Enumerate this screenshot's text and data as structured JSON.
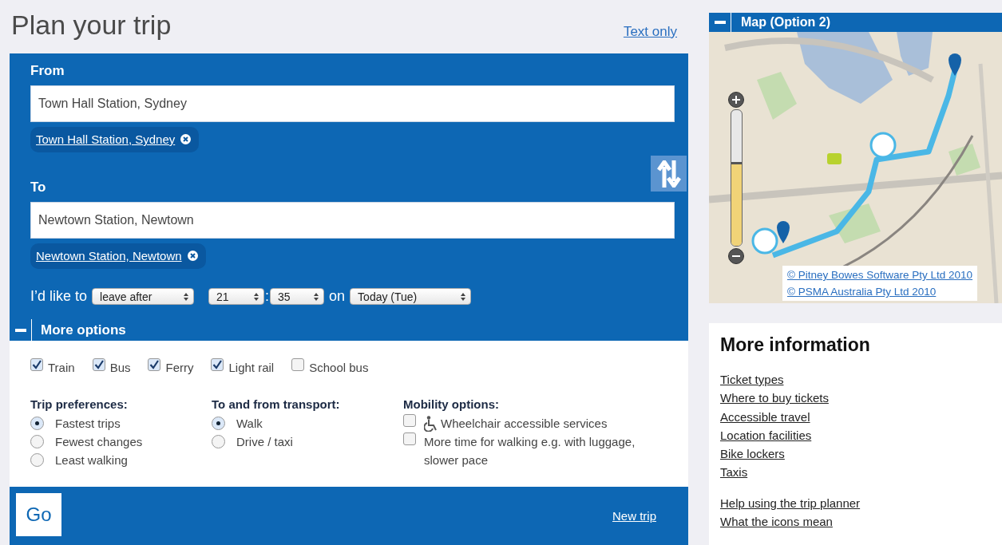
{
  "title": "Plan your trip",
  "text_only_link": "Text only",
  "from": {
    "label": "From",
    "value": "Town Hall Station, Sydney",
    "chip": "Town Hall Station, Sydney"
  },
  "to": {
    "label": "To",
    "value": "Newtown Station, Newtown",
    "chip": "Newtown Station, Newtown"
  },
  "when": {
    "prefix": "I’d like to",
    "mode": "leave after",
    "hour": "21",
    "separator": ":",
    "minute": "35",
    "on": "on",
    "day": "Today (Tue)"
  },
  "more_options": {
    "label": "More options",
    "expanded": true
  },
  "modes": [
    {
      "label": "Train",
      "checked": true
    },
    {
      "label": "Bus",
      "checked": true
    },
    {
      "label": "Ferry",
      "checked": true
    },
    {
      "label": "Light rail",
      "checked": true
    },
    {
      "label": "School bus",
      "checked": false
    }
  ],
  "trip_preferences": {
    "heading": "Trip preferences:",
    "options": [
      {
        "label": "Fastest trips",
        "selected": true
      },
      {
        "label": "Fewest changes",
        "selected": false
      },
      {
        "label": "Least walking",
        "selected": false
      }
    ]
  },
  "transport": {
    "heading": "To and from transport:",
    "options": [
      {
        "label": "Walk",
        "selected": true
      },
      {
        "label": "Drive / taxi",
        "selected": false
      }
    ]
  },
  "mobility": {
    "heading": "Mobility options:",
    "options": [
      {
        "label": "Wheelchair accessible services",
        "checked": false,
        "kind": "wheelchair"
      },
      {
        "label": "More time for walking e.g. with luggage, slower pace",
        "checked": false,
        "kind": "plain"
      }
    ]
  },
  "go_button": "Go",
  "new_trip_link": "New trip",
  "map": {
    "title": "Map (Option 2)",
    "expanded": true,
    "zoom": {
      "level": 0.6
    },
    "credits": [
      "© Pitney Bowes Software Pty Ltd 2010",
      "© PSMA Australia Pty Ltd 2010"
    ]
  },
  "more_information": {
    "title": "More information",
    "groups": [
      [
        "Ticket types",
        "Where to buy tickets",
        "Accessible travel",
        "Location facilities",
        "Bike lockers",
        "Taxis"
      ],
      [
        "Help using the trip planner",
        "What the icons mean"
      ]
    ]
  }
}
